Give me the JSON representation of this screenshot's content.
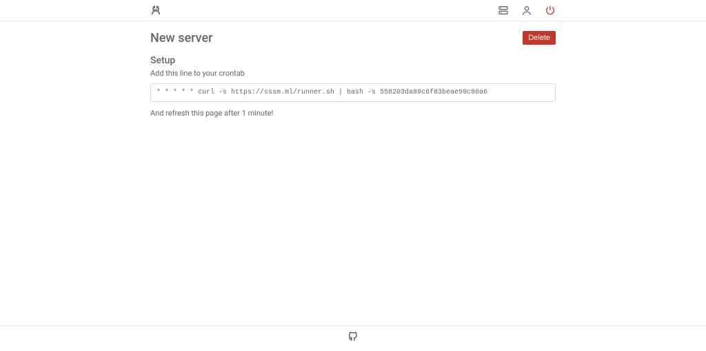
{
  "header": {
    "brand_icon": "cat-icon",
    "nav": [
      {
        "name": "servers-icon"
      },
      {
        "name": "user-icon"
      },
      {
        "name": "power-icon"
      }
    ]
  },
  "page": {
    "title": "New server",
    "delete_label": "Delete",
    "setup_heading": "Setup",
    "instruction": "Add this line to your crontab",
    "crontab_line": "* * * * * curl -s https://sssm.ml/runner.sh | bash -s 558203da89c6f83beae99c80a6",
    "refresh_note": "And refresh this page after 1 minute!"
  },
  "footer": {
    "link_icon": "github-icon"
  }
}
